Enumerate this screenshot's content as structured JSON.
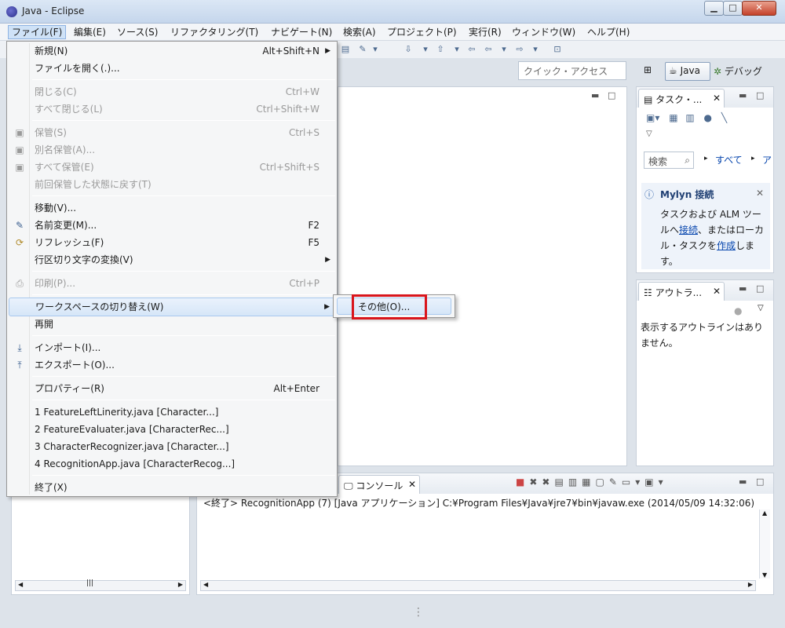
{
  "window": {
    "title": "Java - Eclipse",
    "minimize": "▁",
    "maximize": "□",
    "close": "✕"
  },
  "menubar": [
    "ファイル(F)",
    "編集(E)",
    "ソース(S)",
    "リファクタリング(T)",
    "ナビゲート(N)",
    "検索(A)",
    "プロジェクト(P)",
    "実行(R)",
    "ウィンドウ(W)",
    "ヘルプ(H)"
  ],
  "toolbar": {
    "quick_access_placeholder": "クイック・アクセス",
    "perspective_java": "Java",
    "perspective_debug": "デバッグ"
  },
  "file_menu": [
    {
      "label": "新規(N)",
      "shortcut": "Alt+Shift+N",
      "submenu": true,
      "disabled": false
    },
    {
      "label": "ファイルを開く(.)...",
      "shortcut": "",
      "disabled": false
    },
    {
      "label": "閉じる(C)",
      "shortcut": "Ctrl+W",
      "disabled": true
    },
    {
      "label": "すべて閉じる(L)",
      "shortcut": "Ctrl+Shift+W",
      "disabled": true
    },
    {
      "label": "保管(S)",
      "shortcut": "Ctrl+S",
      "disabled": true
    },
    {
      "label": "別名保管(A)...",
      "shortcut": "",
      "disabled": true
    },
    {
      "label": "すべて保管(E)",
      "shortcut": "Ctrl+Shift+S",
      "disabled": true
    },
    {
      "label": "前回保管した状態に戻す(T)",
      "shortcut": "",
      "disabled": true
    },
    {
      "label": "移動(V)...",
      "shortcut": "",
      "disabled": false
    },
    {
      "label": "名前変更(M)...",
      "shortcut": "F2",
      "disabled": false
    },
    {
      "label": "リフレッシュ(F)",
      "shortcut": "F5",
      "disabled": false
    },
    {
      "label": "行区切り文字の変換(V)",
      "shortcut": "",
      "submenu": true,
      "disabled": false
    },
    {
      "label": "印刷(P)...",
      "shortcut": "Ctrl+P",
      "disabled": true
    },
    {
      "label": "ワークスペースの切り替え(W)",
      "shortcut": "",
      "submenu": true,
      "disabled": false
    },
    {
      "label": "再開",
      "shortcut": "",
      "disabled": false
    },
    {
      "label": "インポート(I)...",
      "shortcut": "",
      "disabled": false
    },
    {
      "label": "エクスポート(O)...",
      "shortcut": "",
      "disabled": false
    },
    {
      "label": "プロパティー(R)",
      "shortcut": "Alt+Enter",
      "disabled": false
    },
    {
      "label": "1 FeatureLeftLinerity.java  [Character...]",
      "shortcut": "",
      "disabled": false
    },
    {
      "label": "2 FeatureEvaluater.java  [CharacterRec...]",
      "shortcut": "",
      "disabled": false
    },
    {
      "label": "3 CharacterRecognizer.java  [Character...]",
      "shortcut": "",
      "disabled": false
    },
    {
      "label": "4 RecognitionApp.java  [CharacterRecog...]",
      "shortcut": "",
      "disabled": false
    },
    {
      "label": "終了(X)",
      "shortcut": "",
      "disabled": false
    }
  ],
  "workspace_submenu": {
    "other": "その他(O)..."
  },
  "task_panel": {
    "tab": "タスク・...",
    "search_placeholder": "検索",
    "all_link": "すべて",
    "other_link": "ア",
    "mylyn_title": "Mylyn 接続",
    "mylyn_text1": "タスクおよび ALM ツールへ",
    "mylyn_link1": "接続",
    "mylyn_text2": "、またはローカル・タスクを",
    "mylyn_link2": "作成",
    "mylyn_text3": "します。"
  },
  "outline_panel": {
    "tab": "アウトラ...",
    "message": "表示するアウトラインはありません。"
  },
  "console_panel": {
    "tab": "コンソール",
    "output": "<終了> RecognitionApp (7) [Java アプリケーション] C:¥Program Files¥Java¥jre7¥bin¥javaw.exe (2014/05/09 14:32:06)"
  },
  "colors": {
    "highlight_red": "#d9151c",
    "menu_hover": "#d6e6f8"
  }
}
